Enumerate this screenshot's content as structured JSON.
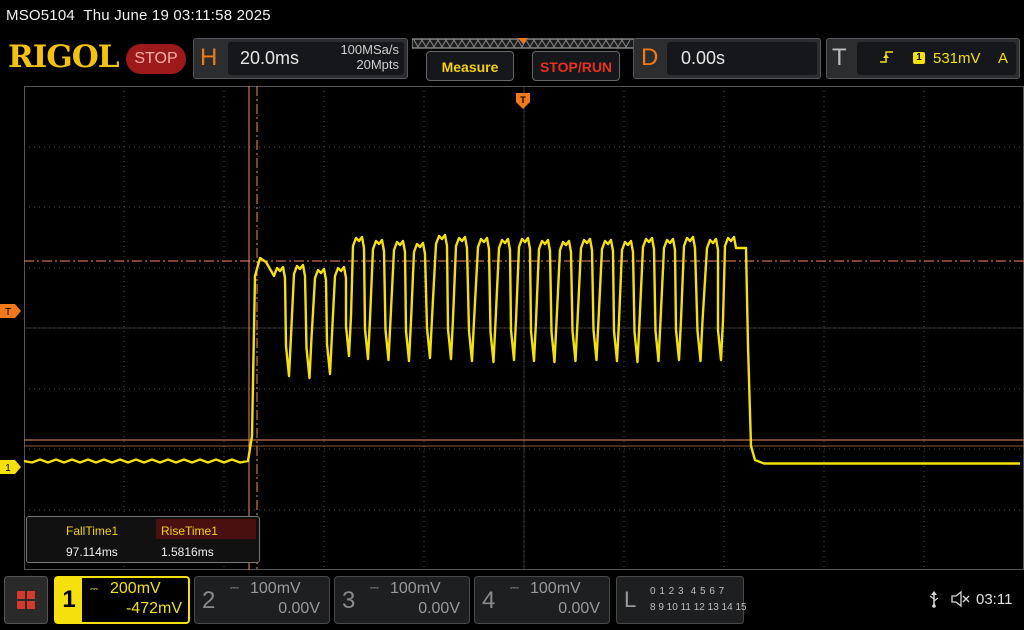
{
  "title_bar": {
    "model": "MSO5104",
    "datetime": "Thu June 19 03:11:58 2025"
  },
  "brand": "RIGOL",
  "run_state": "STOP",
  "horizontal": {
    "letter": "H",
    "timebase": "20.0ms",
    "sample_rate": "100MSa/s",
    "memory_depth": "20Mpts"
  },
  "buttons": {
    "measure": "Measure",
    "stop_run": "STOP/RUN"
  },
  "delay": {
    "letter": "D",
    "value": "0.00s"
  },
  "trigger": {
    "letter": "T",
    "source": "1",
    "level": "531mV",
    "mode": "A",
    "edge_icon": "rising-edge-icon"
  },
  "markers": {
    "trigger_level": "T",
    "channel1": "1"
  },
  "measurements": {
    "items": [
      {
        "label": "FallTime1",
        "value": "97.114ms"
      },
      {
        "label": "RiseTime1",
        "value": "1.5816ms"
      }
    ]
  },
  "channels": [
    {
      "num": "1",
      "scale": "200mV",
      "offset": "-472mV",
      "active": true
    },
    {
      "num": "2",
      "scale": "100mV",
      "offset": "0.00V",
      "active": false
    },
    {
      "num": "3",
      "scale": "100mV",
      "offset": "0.00V",
      "active": false
    },
    {
      "num": "4",
      "scale": "100mV",
      "offset": "0.00V",
      "active": false
    }
  ],
  "logic": {
    "letter": "L",
    "row1": "0 1 2 3  4 5 6 7",
    "row2": "8 9 10 11 12 13 14 15"
  },
  "status": {
    "time": "03:11",
    "usb_icon": "usb-icon",
    "speaker_icon": "speaker-muted-icon"
  },
  "colors": {
    "ch1": "#f4e00d",
    "cursor": "#f08a5a",
    "brand": "#f4c20d",
    "stop": "#9e1a1a",
    "accent": "#f07a1a"
  }
}
